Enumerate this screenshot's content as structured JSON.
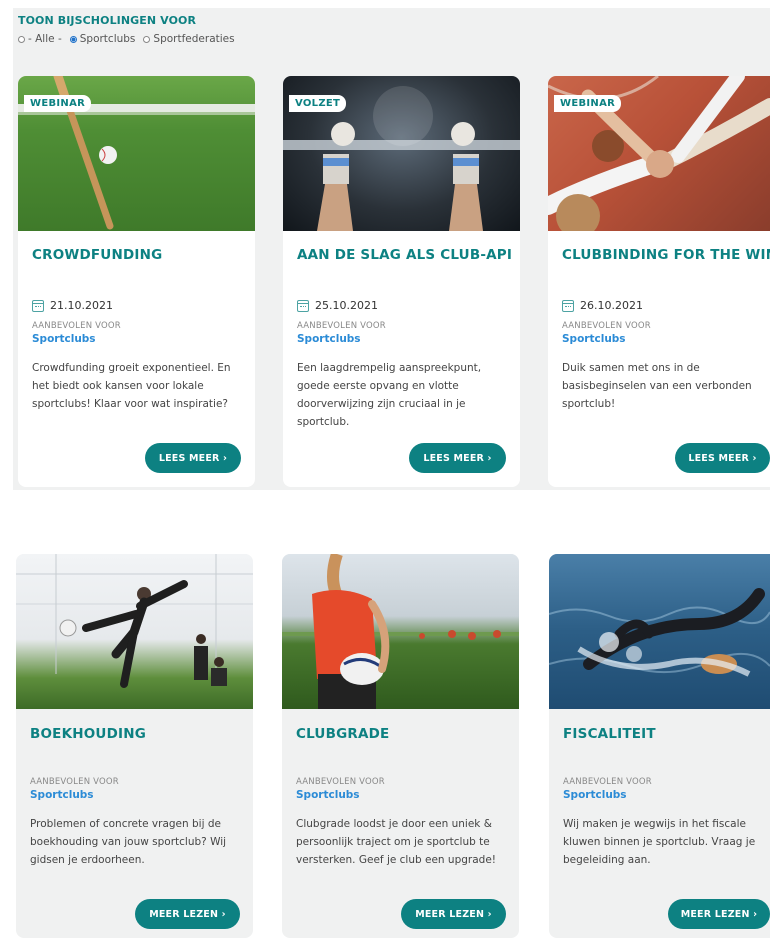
{
  "filter": {
    "title": "TOON BIJSCHOLINGEN VOOR",
    "options": [
      "- Alle -",
      "Sportclubs",
      "Sportfederaties"
    ],
    "selected": "Sportclubs"
  },
  "cards": [
    {
      "badge": "WEBINAR",
      "title": "CROWDFUNDING",
      "date": "21.10.2021",
      "rec_label": "AANBEVOLEN VOOR",
      "rec_value": "Sportclubs",
      "desc": "Crowdfunding groeit exponentieel. En het biedt ook kansen voor lokale sportclubs! Klaar voor wat inspiratie?",
      "button": "LEES MEER ›"
    },
    {
      "badge": "VOLZET",
      "title": "AAN DE SLAG ALS CLUB-API",
      "date": "25.10.2021",
      "rec_label": "AANBEVOLEN VOOR",
      "rec_value": "Sportclubs",
      "desc": "Een laagdrempelig aanspreekpunt, goede eerste opvang en vlotte doorverwijzing zijn cruciaal in je sportclub.",
      "button": "LEES MEER ›"
    },
    {
      "badge": "WEBINAR",
      "title": "CLUBBINDING FOR THE WIN!",
      "date": "26.10.2021",
      "rec_label": "AANBEVOLEN VOOR",
      "rec_value": "Sportclubs",
      "desc": "Duik samen met ons in de basisbeginselen van een verbonden sportclub!",
      "button": "LEES MEER ›"
    },
    {
      "title": "BOEKHOUDING",
      "rec_label": "AANBEVOLEN VOOR",
      "rec_value": "Sportclubs",
      "desc": "Problemen of concrete vragen bij de boekhouding van jouw sportclub? Wij gidsen je erdoorheen.",
      "button": "MEER LEZEN ›"
    },
    {
      "title": "CLUBGRADE",
      "rec_label": "AANBEVOLEN VOOR",
      "rec_value": "Sportclubs",
      "desc": "Clubgrade loodst je door een uniek & persoonlijk traject om je sportclub te versterken. Geef je club een upgrade!",
      "button": "MEER LEZEN ›"
    },
    {
      "title": "FISCALITEIT",
      "rec_label": "AANBEVOLEN VOOR",
      "rec_value": "Sportclubs",
      "desc": "Wij maken je wegwijs in het fiscale kluwen binnen je sportclub. Vraag je begeleiding aan.",
      "button": "MEER LEZEN ›"
    }
  ],
  "colors": {
    "accent": "#0d8182",
    "link": "#2b8bd6",
    "panel": "#f0f1f1"
  }
}
